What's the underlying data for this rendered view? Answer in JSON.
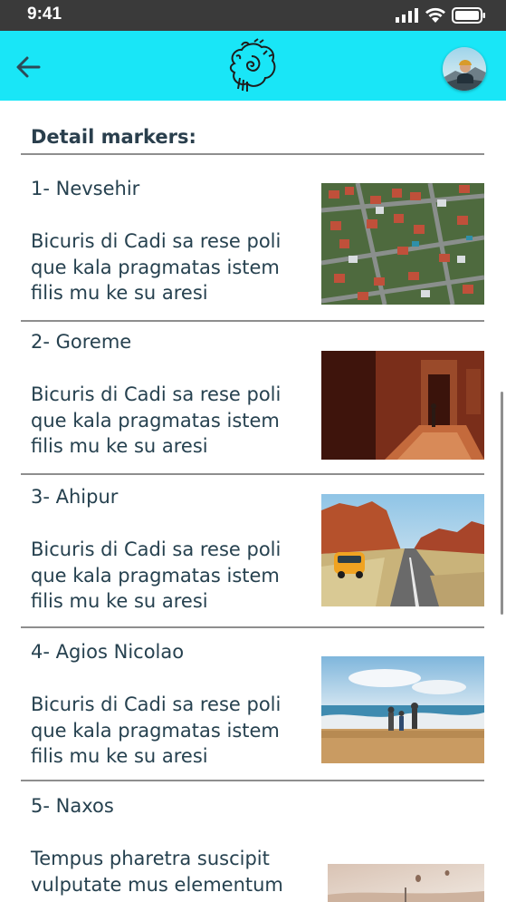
{
  "status": {
    "time": "9:41"
  },
  "header": {
    "back_icon": "arrow-left-icon",
    "logo_icon": "spiral-logo-icon",
    "avatar_icon": "user-avatar"
  },
  "section": {
    "title": "Detail markers:"
  },
  "markers": [
    {
      "title": "1- Nevsehir",
      "description": "Bicuris di Cadi sa rese poli que kala pragmatas istem filis mu ke su aresi",
      "image": "aerial-town-photo"
    },
    {
      "title": "2- Goreme",
      "description": "Bicuris di Cadi sa rese poli que kala pragmatas istem filis mu ke su aresi",
      "image": "canyon-passage-photo"
    },
    {
      "title": "3- Ahipur",
      "description": "Bicuris di Cadi sa rese poli que kala pragmatas istem filis mu ke su aresi",
      "image": "desert-road-van-photo"
    },
    {
      "title": "4- Agios Nicolao",
      "description": "Bicuris di Cadi sa rese poli que kala pragmatas istem filis mu ke su aresi",
      "image": "beach-family-photo"
    },
    {
      "title": "5- Naxos",
      "description": "Tempus pharetra suscipit vulputate mus elementum",
      "image": "balloons-sky-photo"
    }
  ],
  "colors": {
    "header_bg": "#19e6f7",
    "text": "#26414f",
    "status_bg": "#3a3a3a"
  }
}
